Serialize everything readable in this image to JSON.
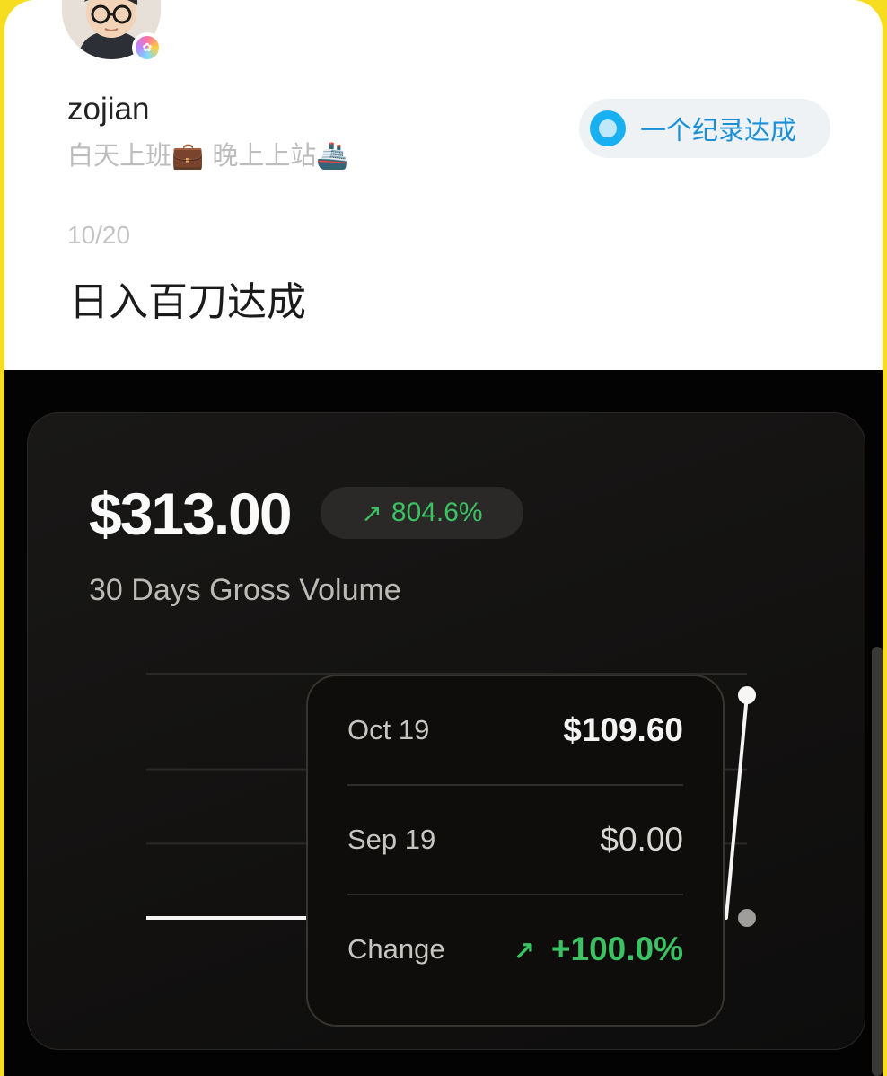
{
  "profile": {
    "username": "zojian",
    "bio": "白天上班💼  晚上上站🚢",
    "achievement_label": "一个纪录达成"
  },
  "post": {
    "date": "10/20",
    "text": "日入百刀达成"
  },
  "stats": {
    "amount": "$313.00",
    "percent": "804.6%",
    "subtitle": "30 Days Gross Volume"
  },
  "tooltip": {
    "row1_label": "Oct 19",
    "row1_value": "$109.60",
    "row2_label": "Sep 19",
    "row2_value": "$0.00",
    "row3_label": "Change",
    "row3_value": "+100.0%"
  },
  "colors": {
    "accent_green": "#3cc163",
    "accent_blue": "#19b0f2",
    "outer_border": "#f6dd1f"
  },
  "chart_data": {
    "type": "line",
    "x": [
      0,
      1,
      2,
      3,
      4,
      5,
      6,
      7,
      8,
      9,
      10,
      11,
      12,
      13,
      14,
      15,
      16,
      17,
      18,
      19,
      20,
      21,
      22,
      23,
      24,
      25,
      26,
      27,
      28,
      29
    ],
    "series": [
      {
        "values": [
          0,
          0,
          0,
          0,
          0,
          0,
          0,
          0,
          0,
          8,
          8,
          0,
          0,
          0,
          0,
          0,
          0,
          0,
          0,
          0,
          0,
          0,
          0,
          0,
          0,
          0,
          0,
          0,
          0,
          92
        ]
      },
      {
        "values": [
          0
        ]
      }
    ],
    "ylim": [
      0,
      92
    ],
    "grid": true
  }
}
